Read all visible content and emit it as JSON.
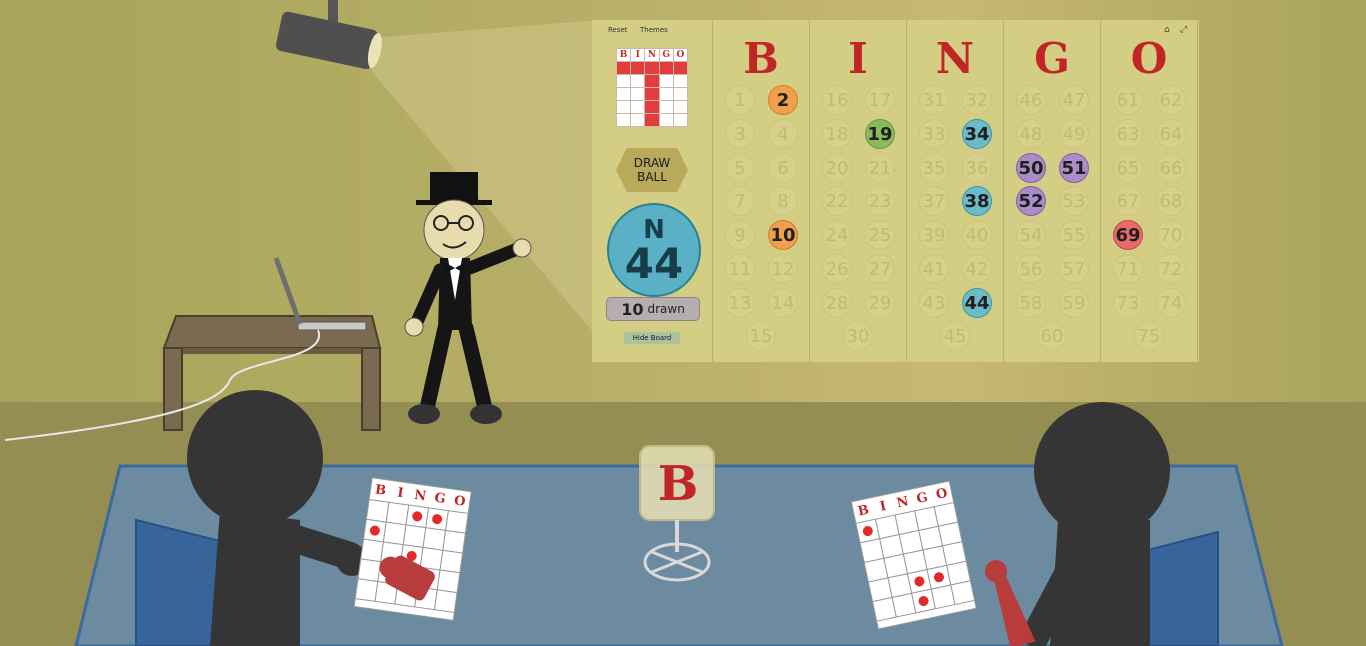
{
  "board": {
    "reset_label": "Reset",
    "themes_label": "Themes",
    "mini_card_letters": [
      "B",
      "I",
      "N",
      "G",
      "O"
    ],
    "draw_button": [
      "DRAW",
      "BALL"
    ],
    "current_ball": {
      "letter": "N",
      "number": "44"
    },
    "drawn_count": "10",
    "drawn_label": "drawn",
    "hide_board_label": "Hide Board",
    "icons": {
      "home": "home-icon",
      "fullscreen": "shrink-icon"
    },
    "columns": [
      {
        "letter": "B",
        "numbers": [
          "1",
          "2",
          "3",
          "4",
          "5",
          "6",
          "7",
          "8",
          "9",
          "10",
          "11",
          "12",
          "13",
          "14",
          "15"
        ]
      },
      {
        "letter": "I",
        "numbers": [
          "16",
          "17",
          "18",
          "19",
          "20",
          "21",
          "22",
          "23",
          "24",
          "25",
          "26",
          "27",
          "28",
          "29",
          "30"
        ]
      },
      {
        "letter": "N",
        "numbers": [
          "31",
          "32",
          "33",
          "34",
          "35",
          "36",
          "37",
          "38",
          "39",
          "40",
          "41",
          "42",
          "43",
          "44",
          "45"
        ]
      },
      {
        "letter": "G",
        "numbers": [
          "46",
          "47",
          "48",
          "49",
          "50",
          "51",
          "52",
          "53",
          "54",
          "55",
          "56",
          "57",
          "58",
          "59",
          "60"
        ]
      },
      {
        "letter": "O",
        "numbers": [
          "61",
          "62",
          "63",
          "64",
          "65",
          "66",
          "67",
          "68",
          "69",
          "70",
          "71",
          "72",
          "73",
          "74",
          "75"
        ]
      }
    ],
    "called": {
      "2": "orange",
      "10": "orange",
      "19": "green",
      "34": "teal",
      "38": "teal",
      "44": "teal",
      "50": "purple",
      "51": "purple",
      "52": "purple",
      "69": "red"
    }
  },
  "cage_letter": "B",
  "player_card_letters": [
    "B",
    "I",
    "N",
    "G",
    "O"
  ],
  "colors": {
    "accent_red": "#c22525",
    "board_bg": "#d4ce84",
    "ball_blue": "#5ab0c4"
  }
}
